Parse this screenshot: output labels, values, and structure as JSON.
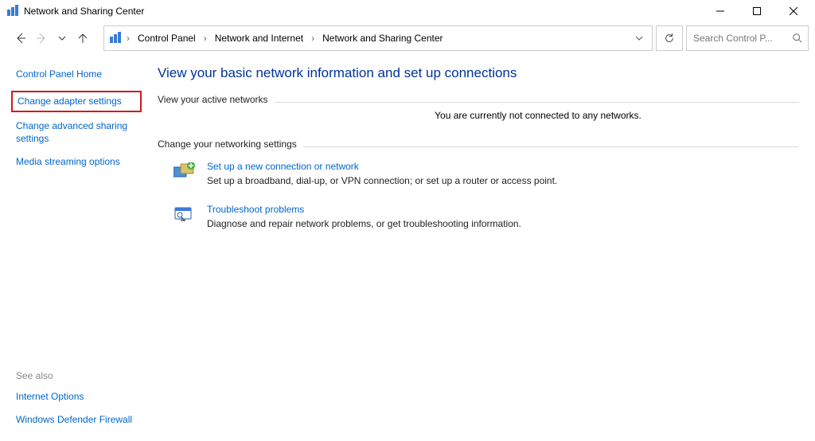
{
  "window": {
    "title": "Network and Sharing Center"
  },
  "breadcrumb": {
    "items": [
      "Control Panel",
      "Network and Internet",
      "Network and Sharing Center"
    ]
  },
  "search": {
    "placeholder": "Search Control P..."
  },
  "sidebar": {
    "links": {
      "home": "Control Panel Home",
      "adapter": "Change adapter settings",
      "advanced": "Change advanced sharing settings",
      "media": "Media streaming options"
    },
    "seealso_label": "See also",
    "seealso": {
      "internet": "Internet Options",
      "firewall": "Windows Defender Firewall"
    }
  },
  "main": {
    "heading": "View your basic network information and set up connections",
    "active_label": "View your active networks",
    "active_msg": "You are currently not connected to any networks.",
    "settings_label": "Change your networking settings",
    "opt1": {
      "link": "Set up a new connection or network",
      "desc": "Set up a broadband, dial-up, or VPN connection; or set up a router or access point."
    },
    "opt2": {
      "link": "Troubleshoot problems",
      "desc": "Diagnose and repair network problems, or get troubleshooting information."
    }
  }
}
